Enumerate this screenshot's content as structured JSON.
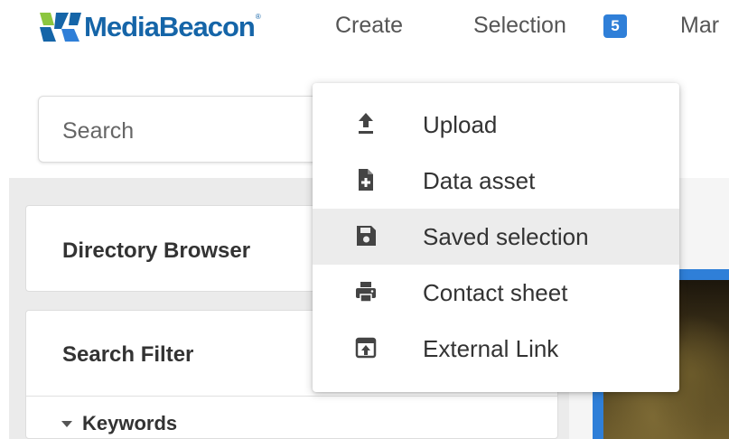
{
  "app": {
    "logo_text": "MediaBeacon",
    "logo_reg": "®"
  },
  "nav": {
    "create": "Create",
    "selection": "Selection",
    "selection_count": "5",
    "manage": "Mar"
  },
  "search": {
    "placeholder": "Search"
  },
  "sidebar": {
    "directory_browser": "Directory Browser",
    "search_filter": "Search Filter",
    "keywords": "Keywords"
  },
  "create_menu": {
    "items": [
      {
        "label": "Upload",
        "icon": "upload-icon"
      },
      {
        "label": "Data asset",
        "icon": "file-plus-icon"
      },
      {
        "label": "Saved selection",
        "icon": "save-icon"
      },
      {
        "label": "Contact sheet",
        "icon": "print-icon"
      },
      {
        "label": "External Link",
        "icon": "external-link-icon"
      }
    ],
    "highlighted_index": 2
  },
  "colors": {
    "brand_blue": "#1565a8",
    "accent_blue": "#2f7fd8",
    "logo_green": "#8cc63f"
  }
}
